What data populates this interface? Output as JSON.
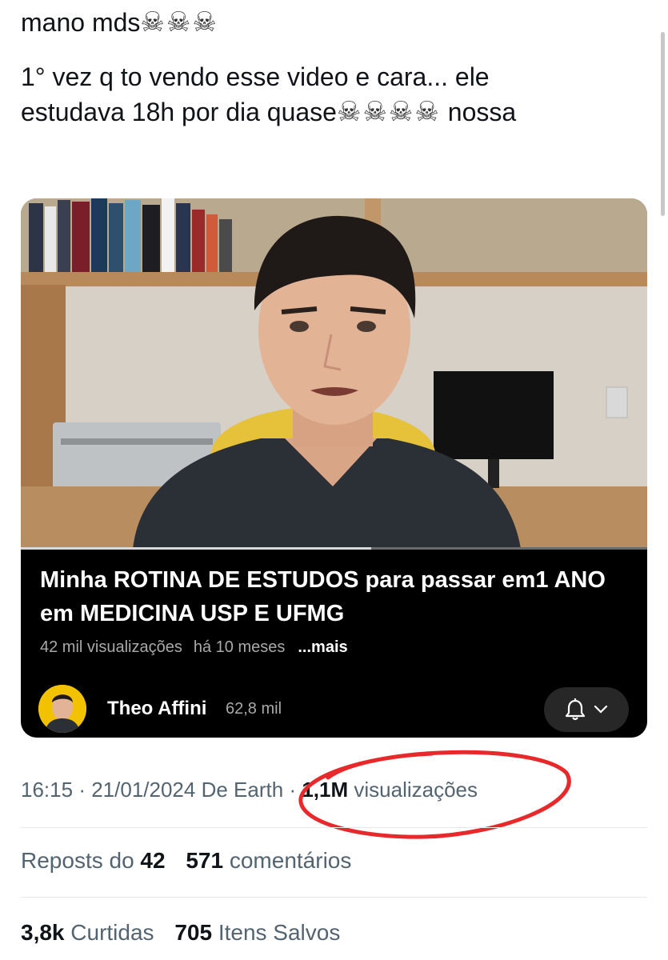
{
  "tweet": {
    "line1_text": "mano mds",
    "line1_emoji": "☠☠☠",
    "line2": "1° vez q to vendo esse video e cara... ele",
    "line3_text": "estudava 18h por dia quase",
    "line3_emoji": "☠☠☠☠",
    "line3_end": "nossa"
  },
  "video_card": {
    "title": "Minha ROTINA DE ESTUDOS para passar em1 ANO em MEDICINA USP E UFMG",
    "views": "42 mil visualizações",
    "age": "há 10 meses",
    "more_label": "...mais",
    "channel_name": "Theo Affini",
    "subscriber_count": "62,8 mil",
    "progress": 0.56,
    "icons": {
      "bell": "bell-icon",
      "chevron": "chevron-down-icon"
    }
  },
  "post_meta": {
    "time": "16:15",
    "separator": "·",
    "date": "21/01/2024",
    "source": "De Earth",
    "separator2": "·",
    "views_count": "1,1M",
    "views_label": "visualizações",
    "highlight_color": "#e8292b"
  },
  "stats": {
    "reposts_label": "Reposts do",
    "reposts_count": "42",
    "comments_count": "571",
    "comments_label": "comentários",
    "likes_count": "3,8k",
    "likes_label": "Curtidas",
    "saves_count": "705",
    "saves_label": "Itens Salvos"
  }
}
